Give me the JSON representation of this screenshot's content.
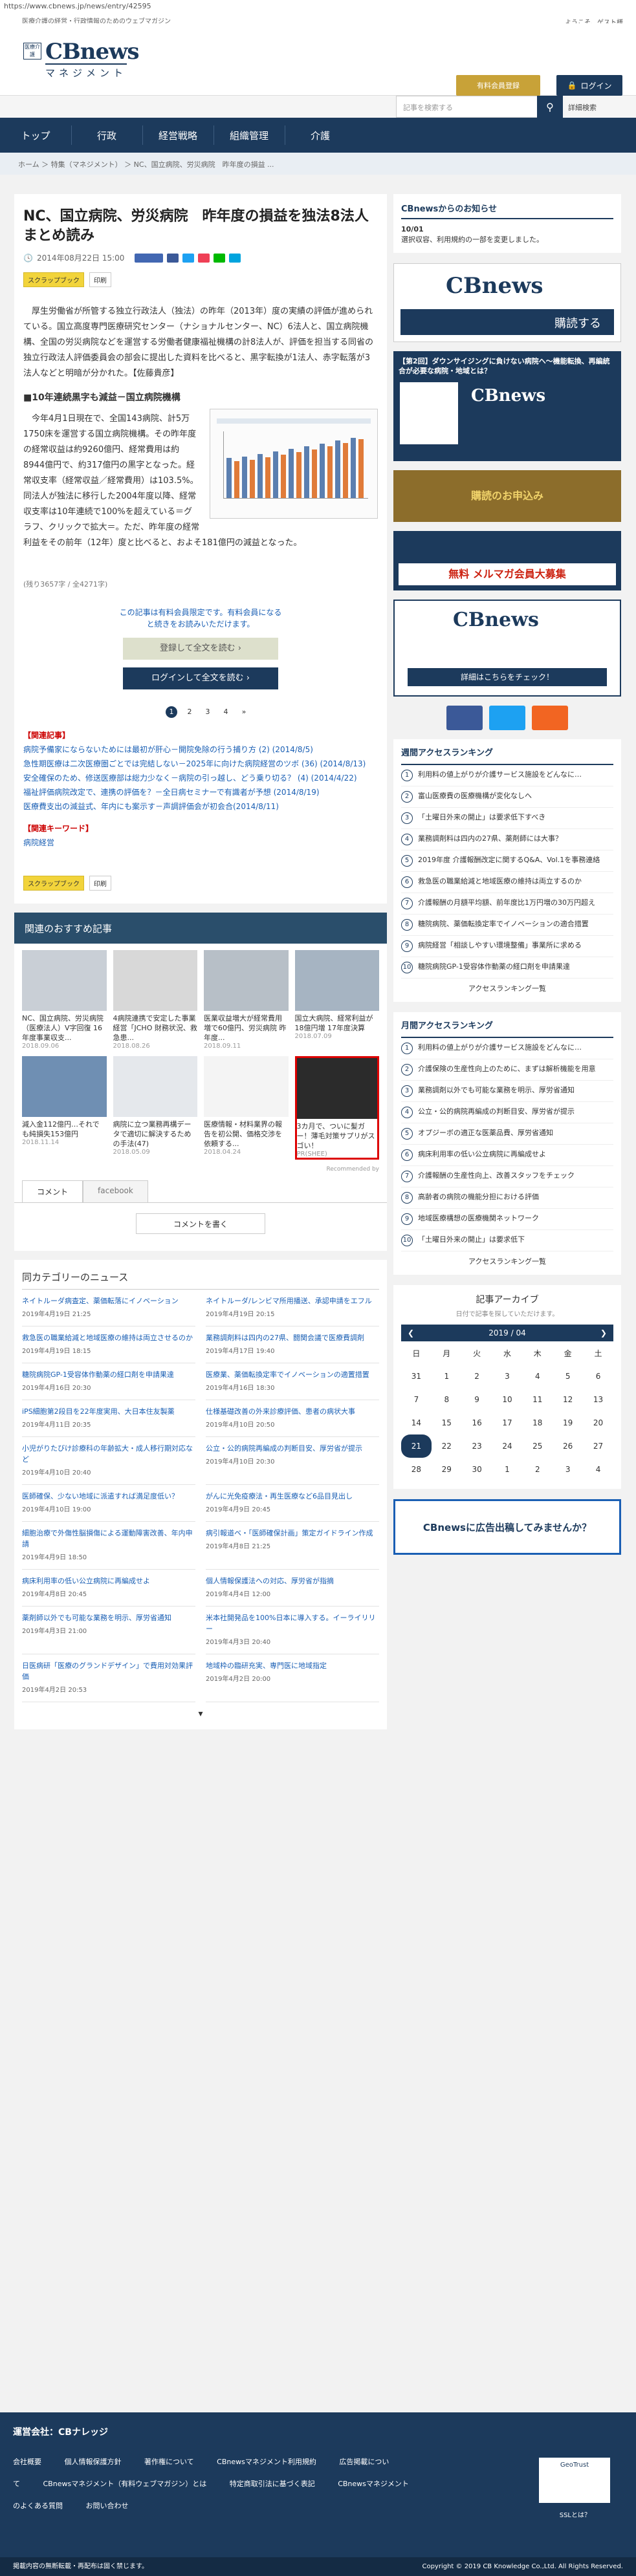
{
  "browser": {
    "url": "https://www.cbnews.jp/news/entry/42595"
  },
  "top": {
    "tagline": "医療介護の経営・行政情報のためのウェブマガジン",
    "welcome": "ようこそ、ゲスト様"
  },
  "brand": {
    "logo_small": "医療介護",
    "logo_main": "CBnews",
    "logo_sub": "マネジメント"
  },
  "header": {
    "trial": "有料会員登録",
    "login": "ログイン",
    "search_placeholder": "記事を検索する",
    "advanced": "詳細検索"
  },
  "nav": [
    "トップ",
    "行政",
    "経営戦略",
    "組織管理",
    "介護"
  ],
  "breadcrumb": "ホーム ＞ 特集（マネジメント） ＞ NC、国立病院、労災病院　昨年度の損益 ...",
  "article": {
    "title": "NC、国立病院、労災病院　昨年度の損益を独法8法人まとめ読み",
    "date": "2014年08月22日 15:00",
    "chips": [
      "スクラップブック",
      "印刷"
    ],
    "p1": "厚生労働省が所管する独立行政法人（独法）の昨年（2013年）度の実績の評価が進められている。国立高度専門医療研究センター（ナショナルセンター、NC）6法人と、国立病院機構、全国の労災病院などを運営する労働者健康福祉機構の計8法人が、評価を担当する同省の独立行政法人評価委員会の部会に提出した資料を比べると、黒字転換が1法人、赤字転落が3法人などと明暗が分かれた。【佐藤貴彦】",
    "h1": "■10年連続黒字も減益－国立病院機構",
    "p2": "今年4月1日現在で、全国143病院、計5万1750床を運営する国立病院機構。その昨年度の経常収益は約9260億円、経常費用は約8944億円で、約317億円の黒字となった。経常収支率（経常収益／経常費用）は103.5%。同法人が独法に移行した2004年度以降、経常収支率は10年連続で100%を超えている＝グラフ、クリックで拡大＝。ただ、昨年度の経常利益をその前年（12年）度と比べると、およそ181億円の減益となった。",
    "rest": "(残り3657字 / 全4271字)",
    "cta_text": "この記事は有料会員限定です。有料会員になると続きをお読みいただけます。",
    "cta1": "登録して全文を読む ›",
    "cta2": "ログインして全文を読む ›",
    "pages": [
      "1",
      "2",
      "3",
      "4",
      "»"
    ],
    "rel_head": "【関連記事】",
    "related": [
      "病院予備家にならないためには最初が肝心－開院免除の行う捕り方 (2) (2014/8/5)",
      "急性期医療は二次医療圏ごとでは完結しない－2025年に向けた病院経営のツボ (36) (2014/8/13)",
      "安全確保のため、修送医療部は総力少なく－病院の引っ越し、どう乗り切る？ (4) (2014/4/22)",
      "福祉評価病院改定で、連携の評価を？－全日病セミナーで有識者が予想 (2014/8/19)",
      "医療費支出の減益式、年内にも案示す－声調評価会が初会合(2014/8/11)"
    ],
    "kw_head": "【関連キーワード】",
    "kw": "病院経営"
  },
  "recommend": {
    "title": "関連のおすすめ記事",
    "items": [
      {
        "c": "NC、国立病院、労災病院（医療法人）V字回復 16年度事業収支...",
        "d": "2018.09.06"
      },
      {
        "c": "4病院連携で安定した事業経営「JCHO 財務状況、救急患...",
        "d": "2018.08.26"
      },
      {
        "c": "医業収益増大が経常費用増で60億円、労災病院 昨年度...",
        "d": "2018.09.11"
      },
      {
        "c": "国立大病院、経常利益が18億円増 17年度決算",
        "d": "2018.07.09"
      },
      {
        "c": "減入金112億円…それでも純損失153億円",
        "d": "2018.11.14"
      },
      {
        "c": "病院に立つ業務再構データで適切に解決するための手法(47)",
        "d": "2018.05.09"
      },
      {
        "c": "医療情報・材料業界の報告を初公開、価格交渉を依頼する...",
        "d": "2018.04.24"
      },
      {
        "c": "3カ月で、ついに髪ガー！薄毛対策サプリがスゴい！",
        "d": "PR(SHEE)"
      }
    ],
    "by": "Recommended by",
    "tab1": "コメント",
    "tab2": "facebook",
    "comment_btn": "コメントを書く"
  },
  "category": {
    "title": "同カテゴリーのニュース",
    "items": [
      {
        "t": "ネイトルーダ病査定、薬価転落にイノベーション",
        "d": "2019年4月19日 21:25"
      },
      {
        "t": "ネイトルーダ/レンビマ所用播送、承認申請をエフル",
        "d": "2019年4月19日 20:15"
      },
      {
        "t": "救急医の職業給減と地域医療の維持は両立させるのか",
        "d": "2019年4月19日 18:15"
      },
      {
        "t": "業務調剤料は四内の27県、闘関会議で医療費調剤",
        "d": "2019年4月17日 19:40"
      },
      {
        "t": "糖院病院GP-1受容体作動薬の経口剤を申請果達",
        "d": "2019年4月16日 20:30"
      },
      {
        "t": "医療業、薬価転換定率でイノベーションの適置措置",
        "d": "2019年4月16日 18:30"
      },
      {
        "t": "iPS細胞第2段目を22年度実用、大日本住友製薬",
        "d": "2019年4月11日 20:35"
      },
      {
        "t": "仕様基礎改善の外来診療評価、患者の病状大事",
        "d": "2019年4月10日 20:50"
      },
      {
        "t": "小児がりたびけ診療科の年齢拡大・成人移行期対応など",
        "d": "2019年4月10日 20:40"
      },
      {
        "t": "公立・公的病院再編成の判断目安、厚労省が提示",
        "d": "2019年4月10日 20:30"
      },
      {
        "t": "医師確保、少ない地域に派遣すれば満足度低い？",
        "d": "2019年4月10日 19:00"
      },
      {
        "t": "がんに光免疫療法・再生医療など6品目見出し",
        "d": "2019年4月9日 20:45"
      },
      {
        "t": "細胞治療で外傷性脳損傷による運動障害改善、年内申請",
        "d": "2019年4月9日 18:50"
      },
      {
        "t": "病引報道ベ・「医師確保計画」策定ガイドライン作成",
        "d": "2019年4月8日 21:25"
      },
      {
        "t": "病床利用率の低い公立病院に再編成せよ",
        "d": "2019年4月8日 20:45"
      },
      {
        "t": "個人情報保護法への対応、厚労省が指摘",
        "d": "2019年4月4日 12:00"
      },
      {
        "t": "薬剤師以外でも可能な業務を明示、厚労省通知",
        "d": "2019年4月3日 21:00"
      },
      {
        "t": "米本社開発品を100%日本に導入する。イーライリリー",
        "d": "2019年4月3日 20:40"
      },
      {
        "t": "日医病研「医療のグランドデザイン」で費用対効果評価",
        "d": "2019年4月2日 20:53"
      },
      {
        "t": "地域枠の臨研充実、専門医に地域指定",
        "d": "2019年4月2日 20:00"
      }
    ]
  },
  "side": {
    "notice_head": "CBnewsからのお知らせ",
    "notice": [
      {
        "d": "10/01",
        "t": "選択収容、利用規約の一部を変更しました。"
      }
    ],
    "b1": "購読する",
    "b2": "【第2回】ダウンサイジングに負けない病院へ～機能転換、再編統合が必要な病院・地域とは？",
    "b3": "購読のお申込み",
    "b4": "無料 メルマガ会員大募集",
    "b5": "詳細はこちらをチェック！",
    "rank1_head": "週間アクセスランキング",
    "rank1": [
      "利用料の値上がりが介護サービス施設をどんなに…",
      "富山医療費の医療機構が変化なしへ",
      "「土曜日外来の開止」は要求低下すべき",
      "業務調剤料は四内の27県、薬剤師には大事？",
      "2019年度 介護報酬改定に関するQ&A、Vol.1を事務連絡",
      "救急医の職業給減と地域医療の維持は両立するのか",
      "介護報酬の月額平均額、前年度比1万円増の30万円超え",
      "糖院病院、薬価転換定率でイノベーションの適合措置",
      "病院経営「相談しやすい環境整備」事業所に求める",
      "糖院病院GP-1受容体作動薬の経口剤を申請果達"
    ],
    "rank1_more": "アクセスランキング一覧",
    "rank2_head": "月間アクセスランキング",
    "rank2": [
      "利用料の値上がりが介護サービス施設をどんなに…",
      "介護保険の生産性向上のために、まずは解析機能を用意",
      "業務調剤以外でも可能な業務を明示、厚労省通知",
      "公立・公的病院再編成の判断目安、厚労省が提示",
      "オプジーボの適正な医薬品費、厚労省通知",
      "病床利用率の低い公立病院に再編成せよ",
      "介護報酬の生産性向上、改善スタッフをチェック",
      "高齢者の病院の機能分担における評価",
      "地域医療構想の医療機関ネットワーク",
      "「土曜日外来の開止」は要求低下"
    ],
    "rank2_more": "アクセスランキング一覧",
    "archive_head": "記事アーカイブ",
    "archive_sub": "日付で記事を探していただけます。",
    "month": "2019 / 04",
    "weekdays": [
      "日",
      "月",
      "火",
      "水",
      "木",
      "金",
      "土"
    ],
    "weeks": [
      [
        "31",
        "1",
        "2",
        "3",
        "4",
        "5",
        "6"
      ],
      [
        "7",
        "8",
        "9",
        "10",
        "11",
        "12",
        "13"
      ],
      [
        "14",
        "15",
        "16",
        "17",
        "18",
        "19",
        "20"
      ],
      [
        "21",
        "22",
        "23",
        "24",
        "25",
        "26",
        "27"
      ],
      [
        "28",
        "29",
        "30",
        "1",
        "2",
        "3",
        "4"
      ]
    ],
    "ad": "CBnewsに広告出稿してみませんか？"
  },
  "footer": {
    "title": "運営会社：CBナレッジ",
    "links": [
      "会社概要",
      "個人情報保護方針",
      "著作権について",
      "CBnewsマネジメント利用規約",
      "広告掲載について",
      "CBnewsマネジメント（有料ウェブマガジン）とは",
      "特定商取引法に基づく表記",
      "CBnewsマネジメントのよくある質問",
      "お問い合わせ"
    ],
    "ssl": "SSLとは？",
    "disclaimer": "掲載内容の無断転載・再配布は固く禁じます。",
    "copyright": "Copyright © 2019 CB Knowledge Co.,Ltd. All Rights Reserved."
  },
  "colors": {
    "navy": "#1c3a5c",
    "gold": "#c8a238"
  }
}
